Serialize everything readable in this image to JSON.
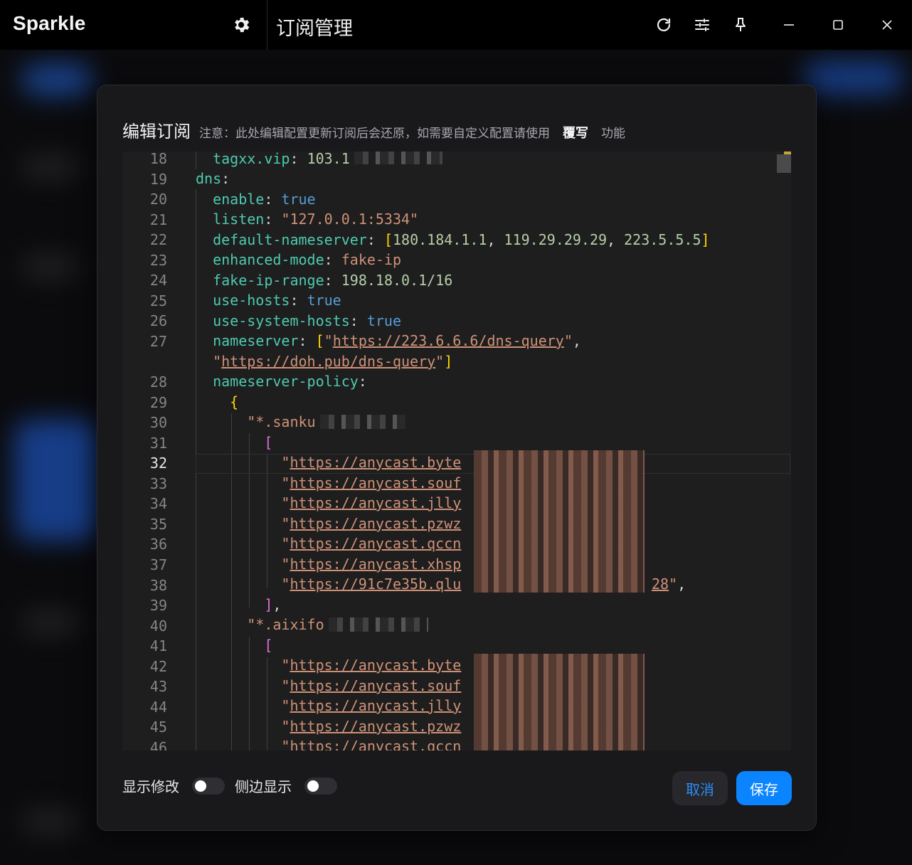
{
  "app": {
    "name": "Sparkle",
    "page_title": "订阅管理"
  },
  "titlebar": {
    "icons": [
      "settings-gear-icon",
      "refresh-icon",
      "sliders-icon",
      "pin-icon",
      "minimize-icon",
      "maximize-icon",
      "close-icon"
    ]
  },
  "modal": {
    "title": "编辑订阅",
    "note": "注意：此处编辑配置更新订阅后会还原，如需要自定义配置请使用",
    "link": "覆写",
    "note_suffix": "功能"
  },
  "editor": {
    "active_line": 32,
    "line_numbers": [
      "18",
      "19",
      "20",
      "21",
      "22",
      "23",
      "24",
      "25",
      "26",
      "27",
      "",
      "28",
      "29",
      "30",
      "31",
      "32",
      "33",
      "34",
      "35",
      "36",
      "37",
      "38",
      "39",
      "40",
      "41",
      "42",
      "43",
      "44",
      "45",
      "46"
    ]
  },
  "footer": {
    "show_changes_label": "显示修改",
    "show_changes_on": false,
    "side_display_label": "侧边显示",
    "side_display_on": false,
    "cancel_label": "取消",
    "save_label": "保存"
  },
  "colors": {
    "accent": "#0a84ff",
    "editor_bg": "#1e1e1e",
    "key": "#4ec9b0",
    "string": "#ce9178",
    "boolean": "#569cd6",
    "number": "#b5cea8"
  }
}
